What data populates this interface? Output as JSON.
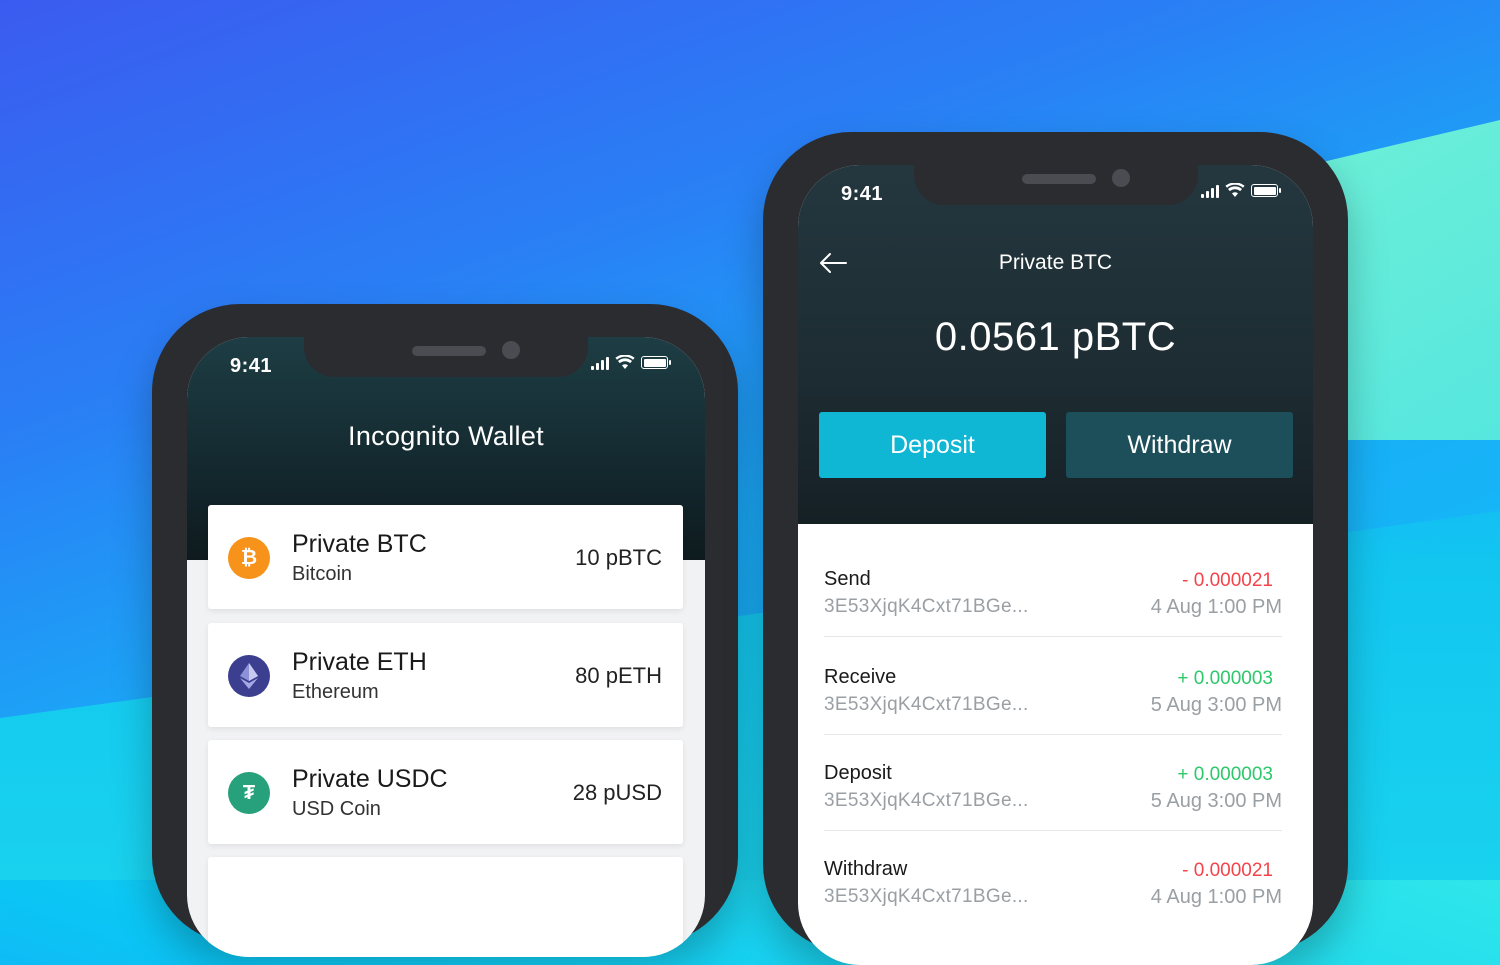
{
  "phone1": {
    "status_time": "9:41",
    "title": "Incognito Wallet",
    "coins": [
      {
        "name": "Private BTC",
        "sub": "Bitcoin",
        "amount": "10 pBTC",
        "icon": "bitcoin-icon",
        "glyph": "₿",
        "color": "#f7931a"
      },
      {
        "name": "Private ETH",
        "sub": "Ethereum",
        "amount": "80 pETH",
        "icon": "ethereum-icon",
        "glyph": "◆",
        "color": "#3c3f8f"
      },
      {
        "name": "Private USDC",
        "sub": "USD Coin",
        "amount": "28 pUSD",
        "icon": "tether-icon",
        "glyph": "₮",
        "color": "#26a17b"
      }
    ]
  },
  "phone2": {
    "status_time": "9:41",
    "title": "Private BTC",
    "balance": "0.0561 pBTC",
    "deposit_label": "Deposit",
    "withdraw_label": "Withdraw",
    "transactions": [
      {
        "type": "Send",
        "address": "3E53XjqK4Cxt71BGe...",
        "amount": "- 0.000021",
        "time": "4 Aug 1:00 PM",
        "sign": "neg"
      },
      {
        "type": "Receive",
        "address": "3E53XjqK4Cxt71BGe...",
        "amount": "+ 0.000003",
        "time": "5 Aug 3:00 PM",
        "sign": "pos"
      },
      {
        "type": "Deposit",
        "address": "3E53XjqK4Cxt71BGe...",
        "amount": "+ 0.000003",
        "time": "5 Aug 3:00 PM",
        "sign": "pos"
      },
      {
        "type": "Withdraw",
        "address": "3E53XjqK4Cxt71BGe...",
        "amount": "- 0.000021",
        "time": "4 Aug 1:00 PM",
        "sign": "neg"
      }
    ]
  },
  "colors": {
    "accent": "#0fb7d4",
    "secondary_button": "#1c4f59",
    "negative": "#f4434a",
    "positive": "#2cc86a"
  }
}
